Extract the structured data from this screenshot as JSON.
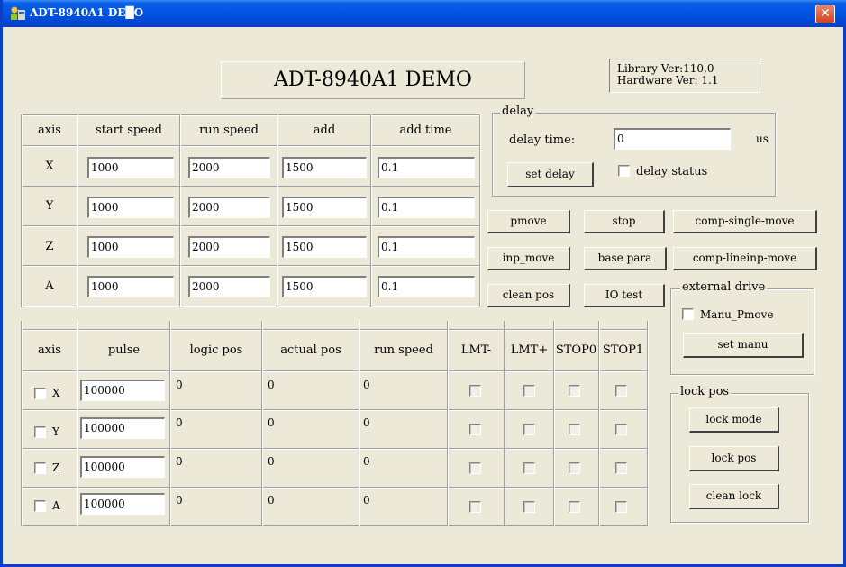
{
  "window": {
    "title": "ADT-8940A1 DE█O",
    "close": "✕"
  },
  "banner": {
    "title": "ADT-8940A1 DEMO"
  },
  "version": {
    "library": "Library Ver:110.0",
    "hardware": "Hardware Ver: 1.1"
  },
  "speed_table": {
    "headers": [
      "axis",
      "start speed",
      "run speed",
      "add",
      "add time"
    ],
    "rows": [
      {
        "axis": "X",
        "start_speed": "1000",
        "run_speed": "2000",
        "add": "1500",
        "add_time": "0.1"
      },
      {
        "axis": "Y",
        "start_speed": "1000",
        "run_speed": "2000",
        "add": "1500",
        "add_time": "0.1"
      },
      {
        "axis": "Z",
        "start_speed": "1000",
        "run_speed": "2000",
        "add": "1500",
        "add_time": "0.1"
      },
      {
        "axis": "A",
        "start_speed": "1000",
        "run_speed": "2000",
        "add": "1500",
        "add_time": "0.1"
      }
    ]
  },
  "delay": {
    "group_title": "delay",
    "time_label": "delay time:",
    "time_value": "0",
    "unit": "us",
    "set_button": "set delay",
    "status_label": "delay status"
  },
  "buttons": {
    "pmove": "pmove",
    "stop": "stop",
    "comp_single": "comp-single-move",
    "inp_move": "inp_move",
    "base_para": "base para",
    "comp_lineinp": "comp-lineinp-move",
    "clean_pos": "clean pos",
    "io_test": "IO test"
  },
  "external_drive": {
    "group_title": "external drive",
    "manu_label": "Manu_Pmove",
    "set_button": "set manu"
  },
  "lock_pos": {
    "group_title": "lock pos",
    "mode_button": "lock mode",
    "pos_button": "lock pos",
    "clean_button": "clean lock"
  },
  "pos_table": {
    "headers": [
      "axis",
      "pulse",
      "logic pos",
      "actual pos",
      "run speed",
      "LMT-",
      "LMT+",
      "STOP0",
      "STOP1"
    ],
    "rows": [
      {
        "axis": "X",
        "pulse": "100000",
        "logic_pos": "0",
        "actual_pos": "0",
        "run_speed": "0"
      },
      {
        "axis": "Y",
        "pulse": "100000",
        "logic_pos": "0",
        "actual_pos": "0",
        "run_speed": "0"
      },
      {
        "axis": "Z",
        "pulse": "100000",
        "logic_pos": "0",
        "actual_pos": "0",
        "run_speed": "0"
      },
      {
        "axis": "A",
        "pulse": "100000",
        "logic_pos": "0",
        "actual_pos": "0",
        "run_speed": "0"
      }
    ]
  },
  "colors": {
    "titlebar": "#0054e3",
    "face": "#ece9d8",
    "close": "#d3431d"
  }
}
